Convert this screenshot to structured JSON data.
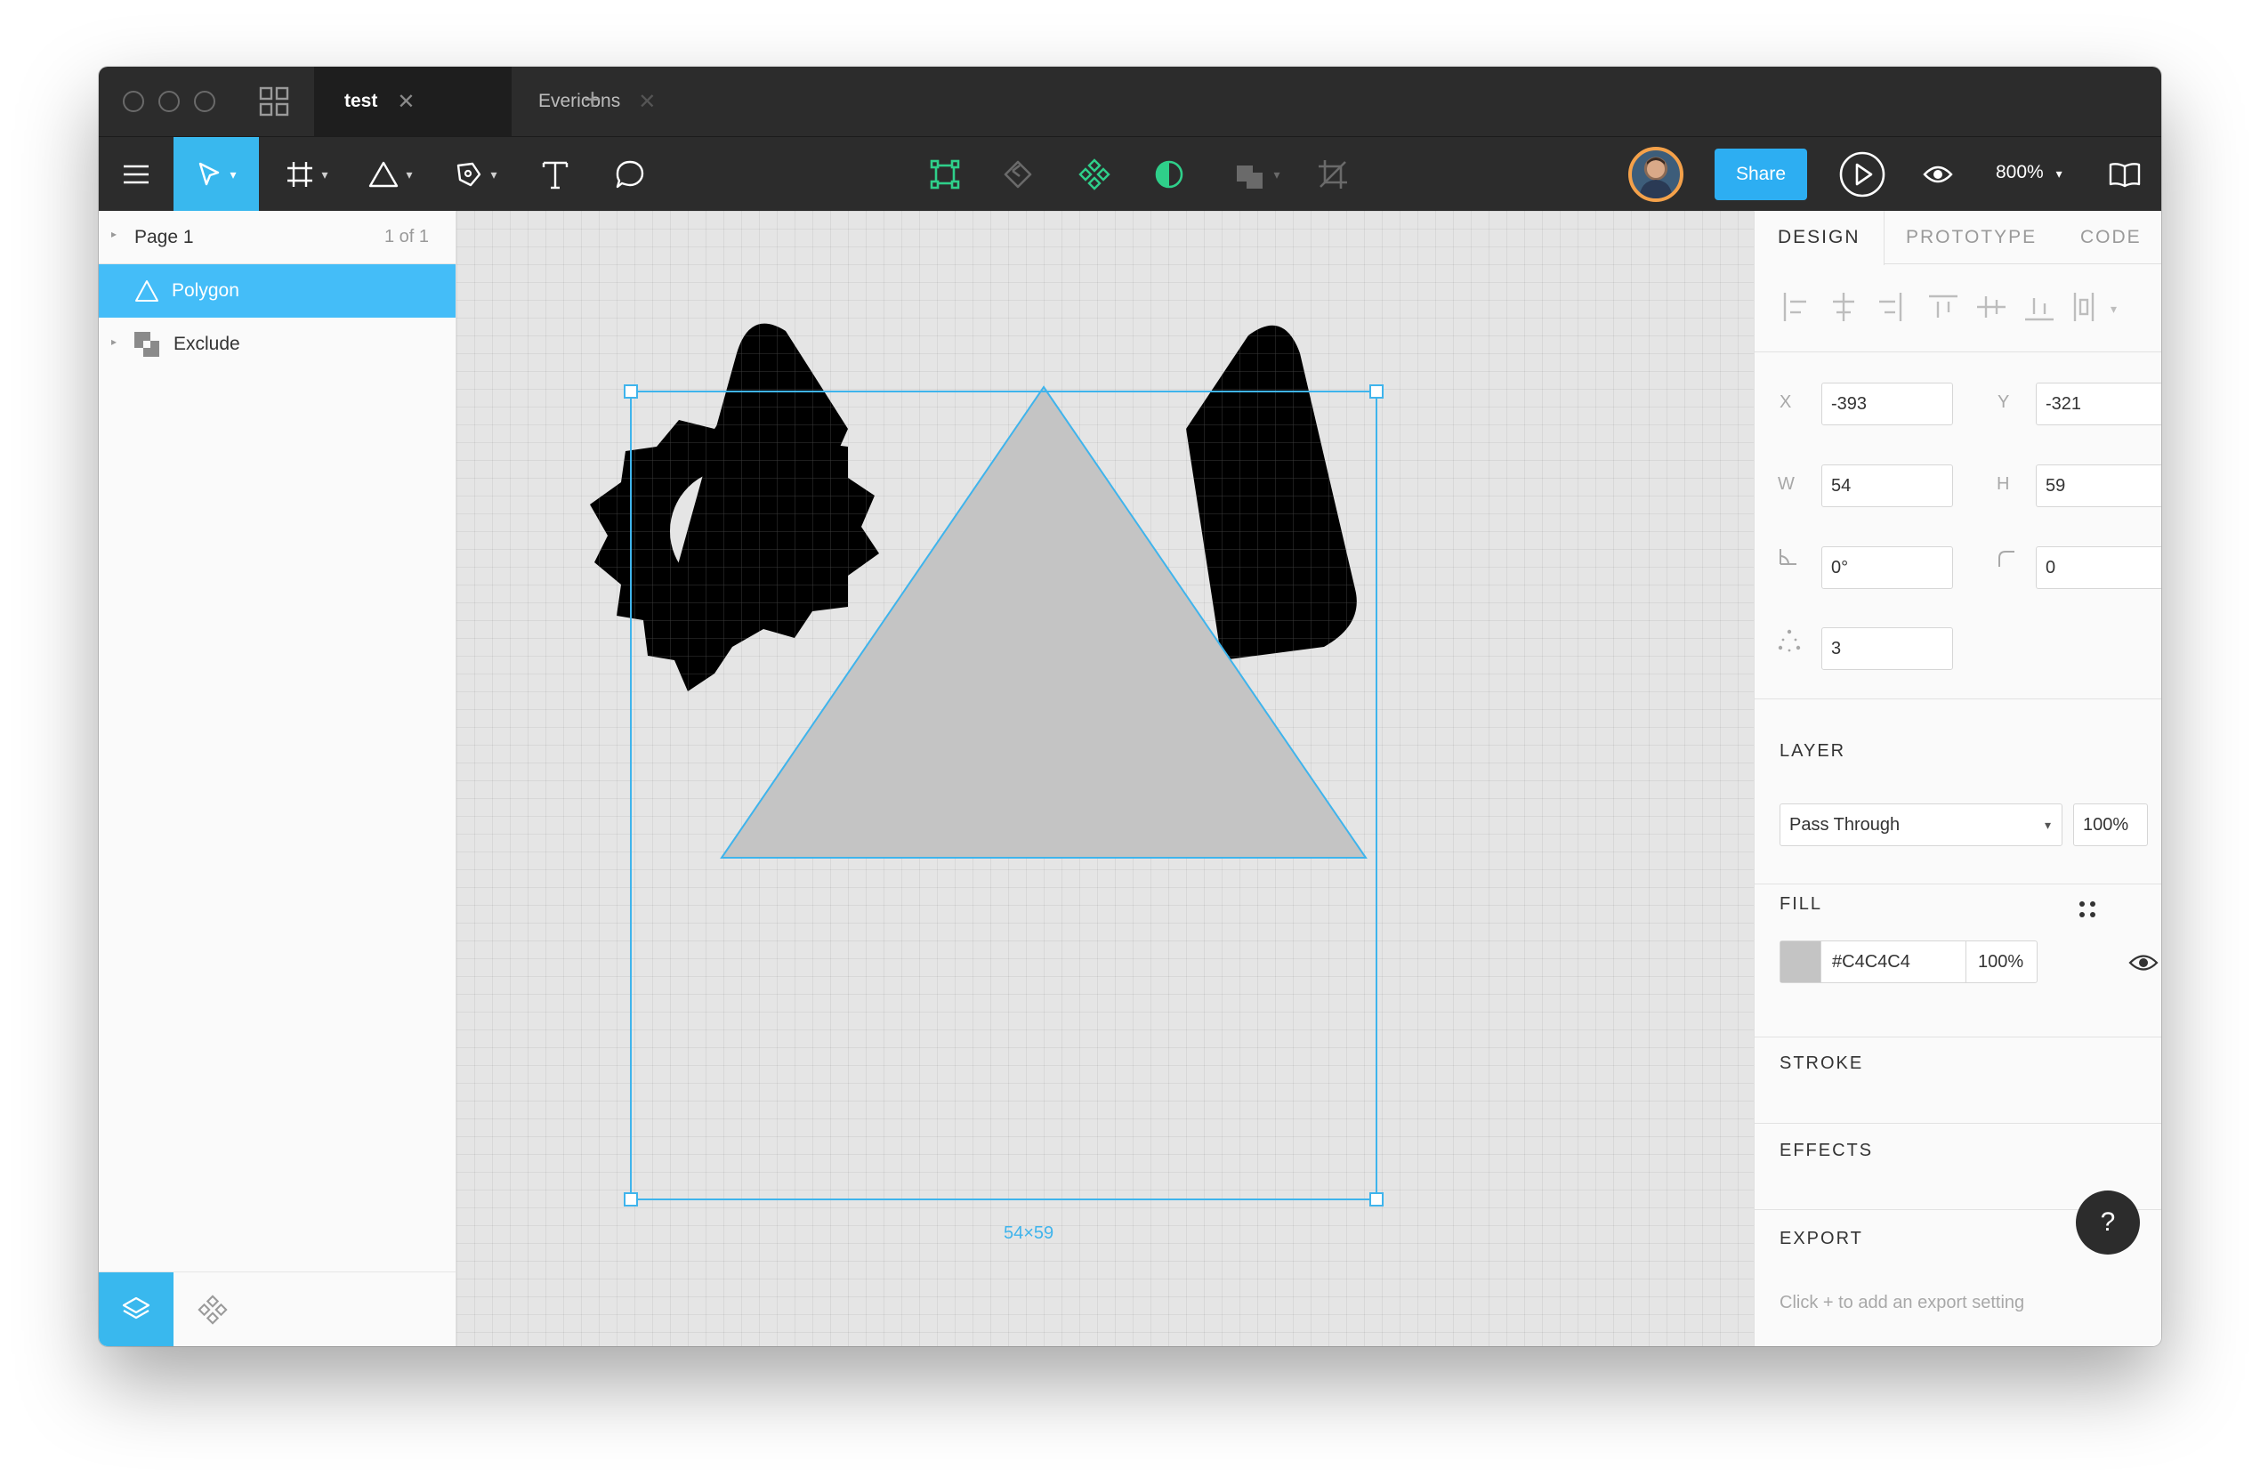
{
  "tabs": [
    {
      "label": "test",
      "active": true
    },
    {
      "label": "Evericons",
      "active": false
    }
  ],
  "toolbar": {
    "share_label": "Share",
    "zoom_label": "800%"
  },
  "left_panel": {
    "page_name": "Page 1",
    "page_count": "1 of 1",
    "layers": [
      {
        "name": "Polygon",
        "selected": true
      },
      {
        "name": "Exclude",
        "selected": false
      }
    ]
  },
  "canvas": {
    "selection_size": "54×59",
    "polygon_fill": "#C4C4C4",
    "selection_color": "#3FB4EC"
  },
  "right_panel": {
    "tabs": [
      "DESIGN",
      "PROTOTYPE",
      "CODE"
    ],
    "fields": {
      "x_label": "X",
      "x_value": "-393",
      "y_label": "Y",
      "y_value": "-321",
      "w_label": "W",
      "w_value": "54",
      "h_label": "H",
      "h_value": "59",
      "rotation_value": "0°",
      "radius_value": "0",
      "count_value": "3"
    },
    "layer": {
      "title": "LAYER",
      "blend_mode": "Pass Through",
      "opacity": "100%"
    },
    "fill": {
      "title": "FILL",
      "hex": "#C4C4C4",
      "opacity": "100%"
    },
    "stroke_title": "STROKE",
    "effects_title": "EFFECTS",
    "export": {
      "title": "EXPORT",
      "hint": "Click + to add an export setting"
    },
    "help_label": "?"
  }
}
